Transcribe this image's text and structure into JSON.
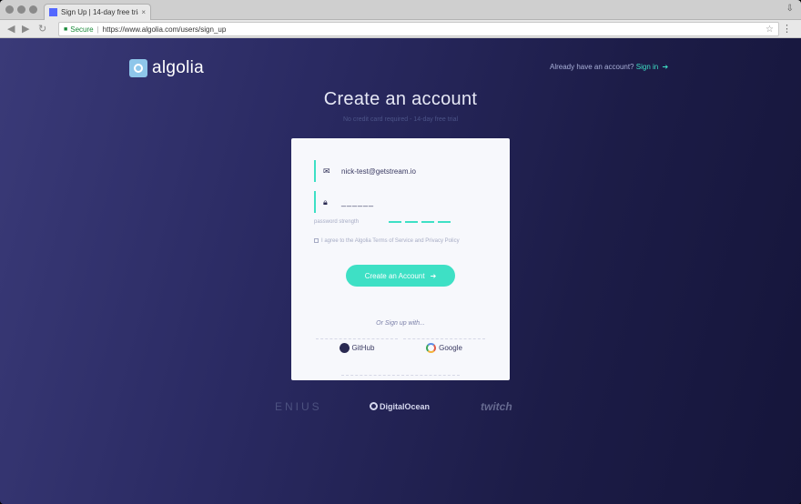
{
  "browser": {
    "tab_title": "Sign Up | 14-day free trial | Al",
    "tab_close": "×",
    "url_secure_label": "Secure",
    "url": "https://www.algolia.com/users/sign_up",
    "nav_back": "◀",
    "nav_forward": "▶",
    "nav_reload": "↻"
  },
  "header": {
    "logo_text": "algolia",
    "signin_prompt": "Already have an account?",
    "signin_link": "Sign in"
  },
  "main": {
    "title": "Create an account",
    "subtitle": "No credit card required - 14-day free trial"
  },
  "form": {
    "email_value": "nick-test@getstream.io",
    "password_value": "______",
    "strength_label": "password strength",
    "terms_text": "I agree to the Algolia Terms of Service and Privacy Policy",
    "create_button": "Create an Account",
    "or_text": "Or Sign up with...",
    "github_label": "GitHub",
    "google_label": "Google"
  },
  "clients": {
    "genius": "ENIUS",
    "digitalocean": "DigitalOcean",
    "twitch": "twitch"
  },
  "colors": {
    "accent": "#3ee0c5",
    "background_start": "#3a3a78",
    "background_end": "#15153a",
    "card": "#f7f8fc"
  }
}
